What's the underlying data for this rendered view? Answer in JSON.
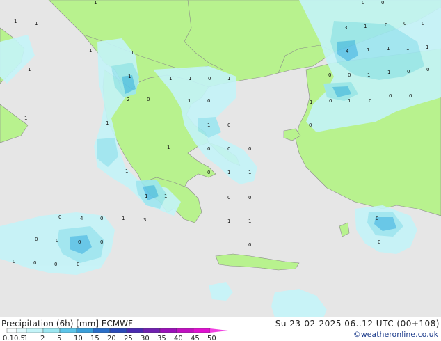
{
  "map": {
    "land_color": "#b8f28e",
    "sea_color": "#e6e6e6",
    "precip_light": "#c4f4f8",
    "precip_medium": "#9ce6f0",
    "precip_heavy": "#5cc4e8",
    "grid_values": [
      "1",
      "1",
      "0",
      "0",
      "1",
      "1",
      "3",
      "1",
      "0",
      "0",
      "0",
      "1",
      "1",
      "4",
      "1",
      "1",
      "1",
      "1",
      "1",
      "1",
      "1",
      "0",
      "1",
      "0",
      "0",
      "1",
      "1",
      "0",
      "0",
      "2",
      "0",
      "1",
      "0",
      "0",
      "1",
      "0",
      "0",
      "0",
      "1",
      "1",
      "1",
      "1",
      "0",
      "0",
      "1",
      "1",
      "0",
      "0",
      "0",
      "1",
      "0",
      "1",
      "1",
      "1",
      "1",
      "0",
      "0",
      "0",
      "4",
      "0",
      "1",
      "3",
      "1",
      "1",
      "0",
      "0",
      "0",
      "0",
      "0",
      "0",
      "0",
      "0",
      "0",
      "0",
      "0"
    ]
  },
  "footer": {
    "title": "Precipitation (6h) [mm] ECMWF",
    "timestamp": "Su 23-02-2025 06..12 UTC (00+108)",
    "credit": "©weatheronline.co.uk",
    "legend_ticks": [
      "0.1",
      "0.5",
      "1",
      "2",
      "5",
      "10",
      "15",
      "20",
      "25",
      "30",
      "35",
      "40",
      "45",
      "50"
    ],
    "legend_colors": [
      "#f5fdfe",
      "#dff8fb",
      "#c4f4f8",
      "#9ce6f0",
      "#5cc4e8",
      "#3a9ed8",
      "#2a6ec8",
      "#2a4ab8",
      "#4a2ab0",
      "#7020b0",
      "#9a10b8",
      "#c010c0",
      "#e010d0",
      "#f040e0"
    ]
  }
}
